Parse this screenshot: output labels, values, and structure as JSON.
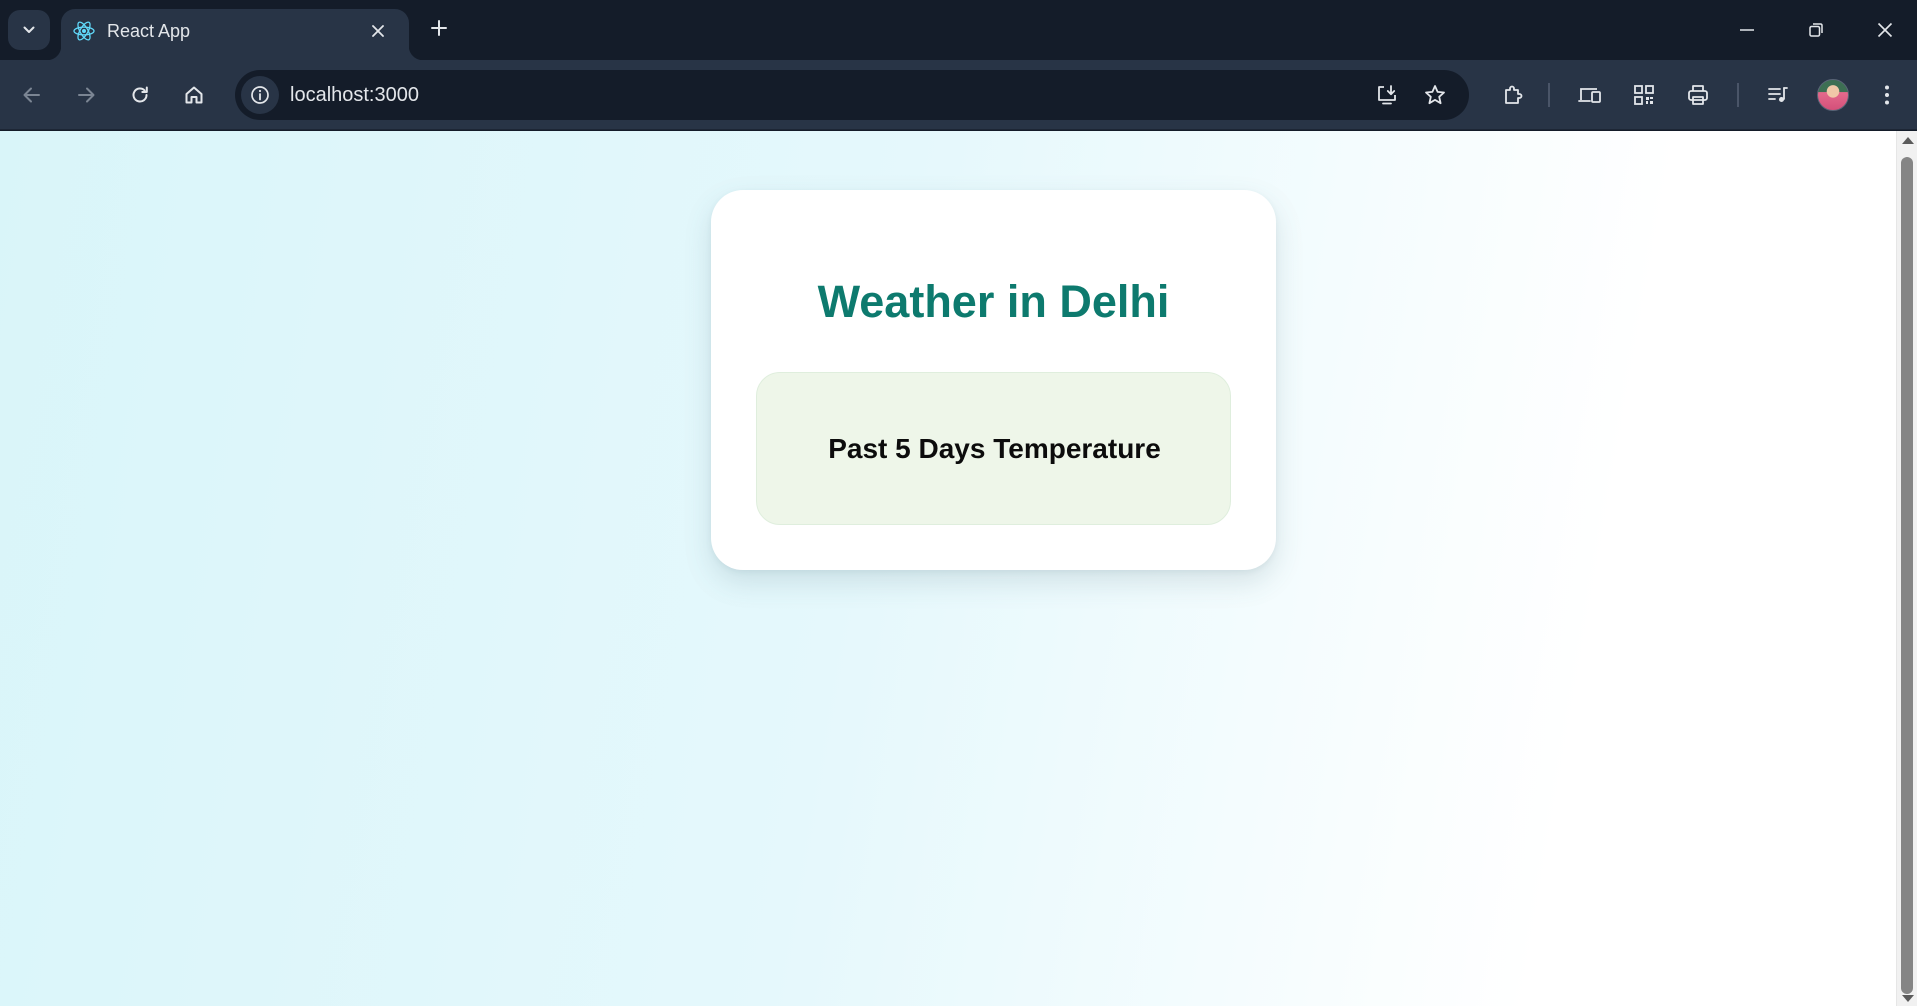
{
  "browser": {
    "tab_title": "React App",
    "url": "localhost:3000",
    "icons": {
      "tab_search": "chevron-down-icon",
      "favicon": "react-logo-icon",
      "tab_close": "close-icon",
      "new_tab": "plus-icon",
      "minimize": "minimize-icon",
      "restore": "restore-icon",
      "close_window": "close-icon",
      "back": "arrow-left-icon",
      "forward": "arrow-right-icon",
      "reload": "reload-icon",
      "home": "home-icon",
      "site_info": "info-icon",
      "install_app": "install-app-icon",
      "bookmark": "star-icon",
      "extensions": "puzzle-icon",
      "devices": "devices-icon",
      "qr_code": "qr-code-icon",
      "print": "printer-icon",
      "media_control": "media-queue-icon",
      "profile": "avatar",
      "menu": "kebab-menu-icon"
    }
  },
  "page": {
    "card_title": "Weather in Delhi",
    "temperature_section_title": "Past 5 Days Temperature"
  },
  "colors": {
    "title": "#0d7a6e",
    "section_background": "#eef6e9",
    "card_background": "#ffffff",
    "browser_frame": "#141c29",
    "toolbar": "#283446"
  }
}
